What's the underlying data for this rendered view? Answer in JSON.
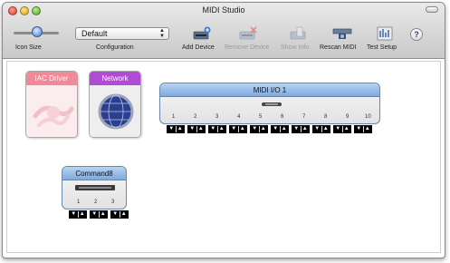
{
  "window": {
    "title": "MIDI Studio"
  },
  "toolbar": {
    "icon_size_label": "Icon Size",
    "configuration_label": "Configuration",
    "configuration_value": "Default",
    "add_device": "Add Device",
    "remove_device": "Remove Device",
    "show_info": "Show Info",
    "rescan_midi": "Rescan MIDI",
    "test_setup": "Test Setup",
    "help": "?"
  },
  "devices": [
    {
      "label": "IAC Driver",
      "color": "#f07a8e"
    },
    {
      "label": "Network",
      "color": "#b14ad4"
    }
  ],
  "interface": {
    "name": "MIDI I/O 1",
    "ports": [
      "1",
      "2",
      "3",
      "4",
      "5",
      "6",
      "7",
      "8",
      "9",
      "10"
    ]
  },
  "command8": {
    "name": "Command8",
    "ports": [
      "1",
      "2",
      "3"
    ]
  },
  "colors": {
    "accent": "#7fa9dd",
    "titlebar": "#d6d6d6"
  }
}
